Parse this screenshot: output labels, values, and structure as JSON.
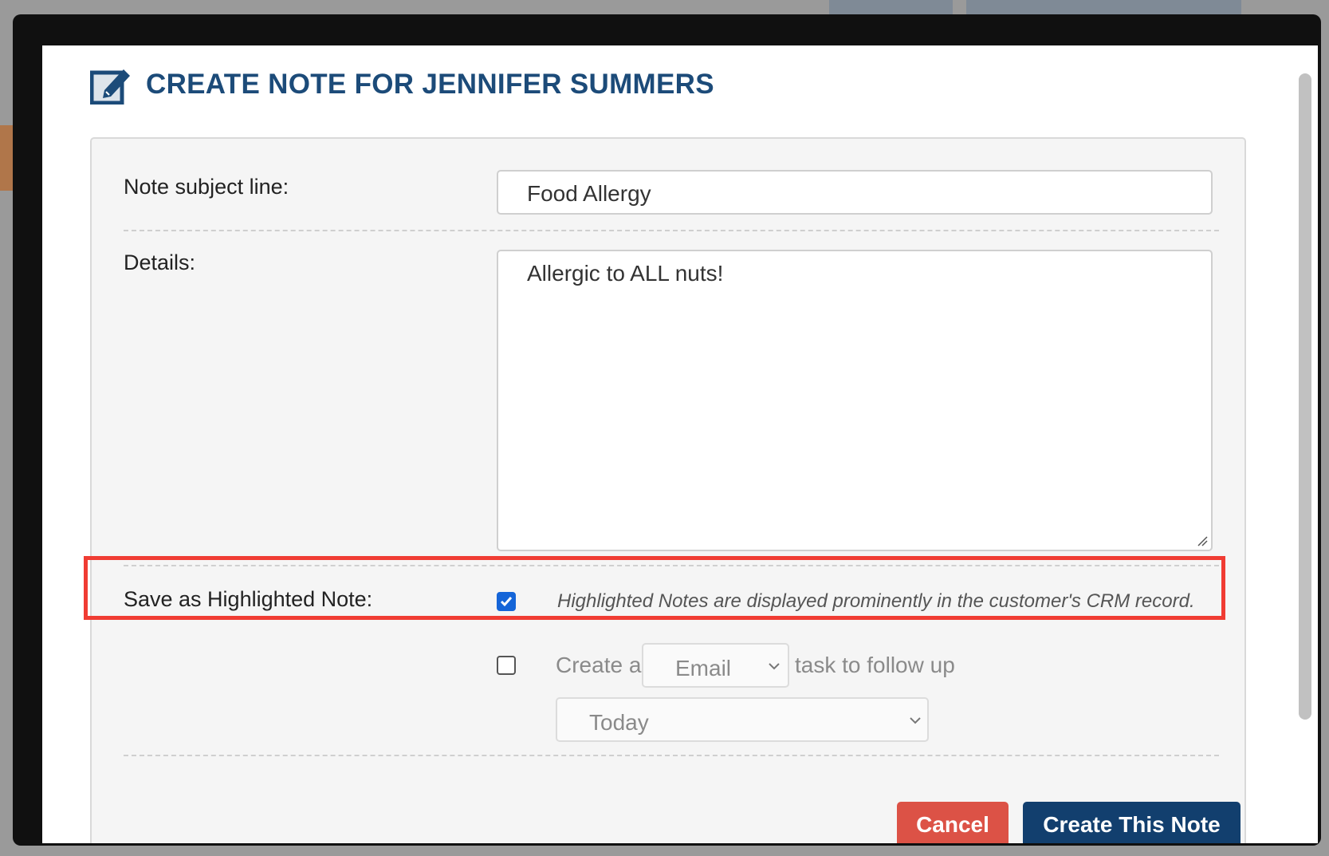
{
  "dialog": {
    "title": "CREATE NOTE FOR JENNIFER SUMMERS",
    "accent_color": "#1c4b79",
    "icon": "edit-note-icon"
  },
  "form": {
    "subject_label": "Note subject line:",
    "subject_value": "Food Allergy",
    "details_label": "Details:",
    "details_value": "Allergic to ALL nuts!",
    "highlight_label": "Save as Highlighted Note:",
    "highlight_checked": true,
    "highlight_hint": "Highlighted Notes are displayed prominently in the customer's CRM record.",
    "task_checked": false,
    "task_prefix": "Create a",
    "task_type": "Email",
    "task_suffix": "task to follow up",
    "task_due": "Today"
  },
  "actions": {
    "cancel_label": "Cancel",
    "cancel_color": "#dc5246",
    "create_label": "Create This Note",
    "create_color": "#123f6e"
  },
  "annotation": {
    "highlight_box_color": "#f03c33"
  }
}
